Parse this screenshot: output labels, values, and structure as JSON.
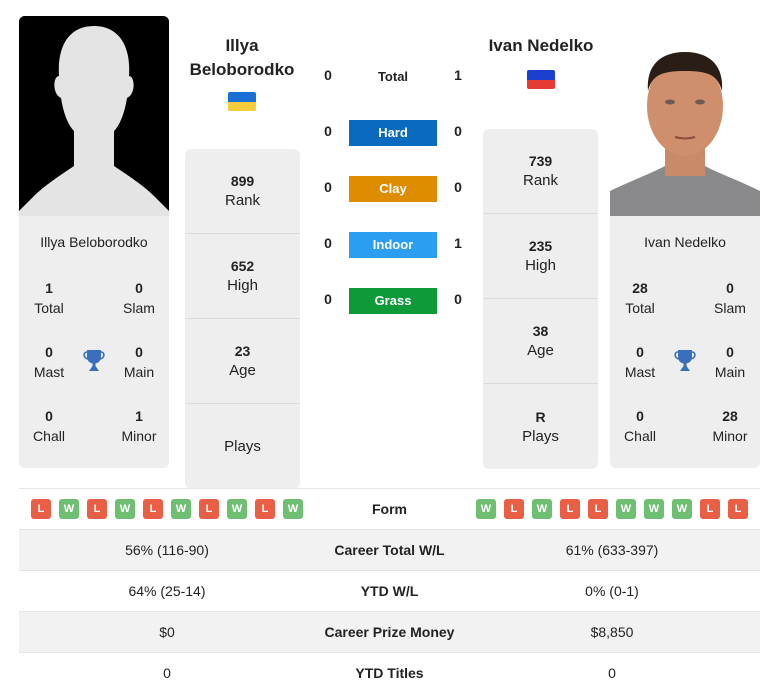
{
  "player1": {
    "name": "Illya Beloborodko",
    "header_name_line1": "Illya",
    "header_name_line2": "Beloborodko",
    "flag": [
      "#1a6fd6",
      "#f6cc3a"
    ],
    "photo": "silhouette",
    "stats": [
      {
        "value": "899",
        "label": "Rank"
      },
      {
        "value": "652",
        "label": "High"
      },
      {
        "value": "23",
        "label": "Age"
      },
      {
        "value": "",
        "label": "Plays"
      }
    ],
    "titles": {
      "total": {
        "value": "1",
        "label": "Total"
      },
      "slam": {
        "value": "0",
        "label": "Slam"
      },
      "mast": {
        "value": "0",
        "label": "Mast"
      },
      "main": {
        "value": "0",
        "label": "Main"
      },
      "chall": {
        "value": "0",
        "label": "Chall"
      },
      "minor": {
        "value": "1",
        "label": "Minor"
      }
    },
    "form": [
      "L",
      "W",
      "L",
      "W",
      "L",
      "W",
      "L",
      "W",
      "L",
      "W"
    ]
  },
  "player2": {
    "name": "Ivan Nedelko",
    "flag": [
      "#1c3fd0",
      "#e63b32"
    ],
    "photo": "headshot",
    "stats": [
      {
        "value": "739",
        "label": "Rank"
      },
      {
        "value": "235",
        "label": "High"
      },
      {
        "value": "38",
        "label": "Age"
      },
      {
        "value": "R",
        "label": "Plays"
      }
    ],
    "titles": {
      "total": {
        "value": "28",
        "label": "Total"
      },
      "slam": {
        "value": "0",
        "label": "Slam"
      },
      "mast": {
        "value": "0",
        "label": "Mast"
      },
      "main": {
        "value": "0",
        "label": "Main"
      },
      "chall": {
        "value": "0",
        "label": "Chall"
      },
      "minor": {
        "value": "28",
        "label": "Minor"
      }
    },
    "form": [
      "W",
      "L",
      "W",
      "L",
      "L",
      "W",
      "W",
      "W",
      "L",
      "L"
    ]
  },
  "h2h": {
    "total": {
      "label": "Total",
      "p1": "0",
      "p2": "1"
    },
    "surfaces": [
      {
        "label": "Hard",
        "p1": "0",
        "p2": "0",
        "color": "#0a6ac0"
      },
      {
        "label": "Clay",
        "p1": "0",
        "p2": "0",
        "color": "#de8c00"
      },
      {
        "label": "Indoor",
        "p1": "0",
        "p2": "1",
        "color": "#2b9ef2"
      },
      {
        "label": "Grass",
        "p1": "0",
        "p2": "0",
        "color": "#0f9a3a"
      }
    ]
  },
  "comparison": {
    "form_label": "Form",
    "rows": [
      {
        "label": "Career Total W/L",
        "p1": "56% (116-90)",
        "p2": "61% (633-397)"
      },
      {
        "label": "YTD W/L",
        "p1": "64% (25-14)",
        "p2": "0% (0-1)"
      },
      {
        "label": "Career Prize Money",
        "p1": "$0",
        "p2": "$8,850"
      },
      {
        "label": "YTD Titles",
        "p1": "0",
        "p2": "0"
      }
    ]
  },
  "colors": {
    "win": "#6fbf73",
    "loss": "#e95f45",
    "trophy": "#3a6fbd",
    "card_bg": "#eeeeee"
  }
}
